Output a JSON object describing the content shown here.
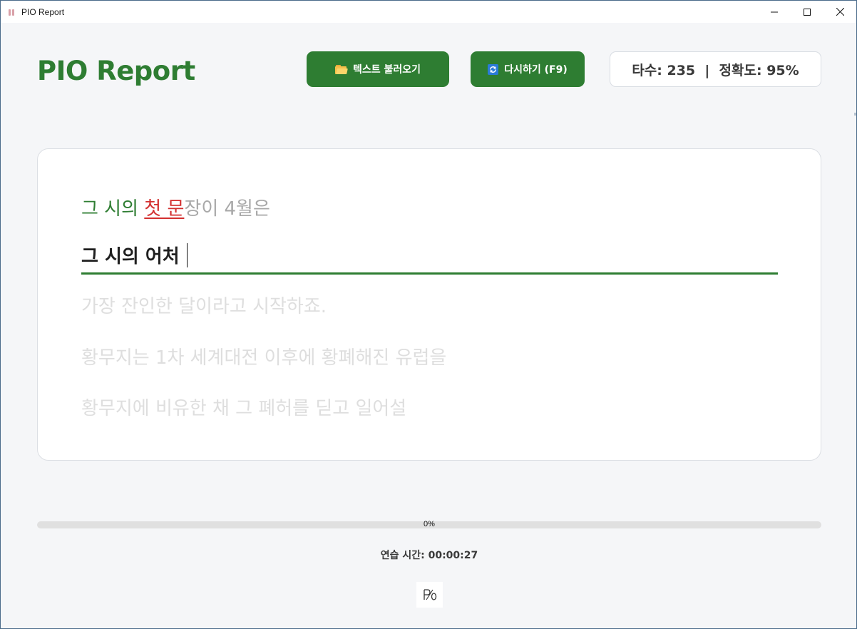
{
  "window": {
    "title": "PIO Report"
  },
  "header": {
    "app_title": "PIO Report",
    "load_button_label": "텍스트 불러오기",
    "retry_button_label": "다시하기 (F9)",
    "stats": {
      "speed_label": "타수",
      "speed_value": "235",
      "accuracy_label": "정확도",
      "accuracy_value": "95%",
      "text": "타수: 235  |  정확도: 95%"
    }
  },
  "practice": {
    "current_line": {
      "correct": "그 시의 ",
      "wrong": "첫 문",
      "remaining": "장이 4월은"
    },
    "typed_input": "그 시의 어처",
    "upcoming_lines": [
      "가장 잔인한 달이라고 시작하죠.",
      "황무지는 1차 세계대전 이후에 황폐해진 유럽을",
      "황무지에 비유한 채 그 폐허를 딛고 일어설"
    ]
  },
  "progress": {
    "percent": 0,
    "label": "0%"
  },
  "timer": {
    "text": "연습 시간: 00:00:27"
  },
  "colors": {
    "accent": "#2e7d32",
    "error": "#d32f2f",
    "background": "#f5f6f8"
  },
  "icons": {
    "load": "folder-icon",
    "retry": "refresh-icon",
    "footer": "pio-logo-icon"
  }
}
